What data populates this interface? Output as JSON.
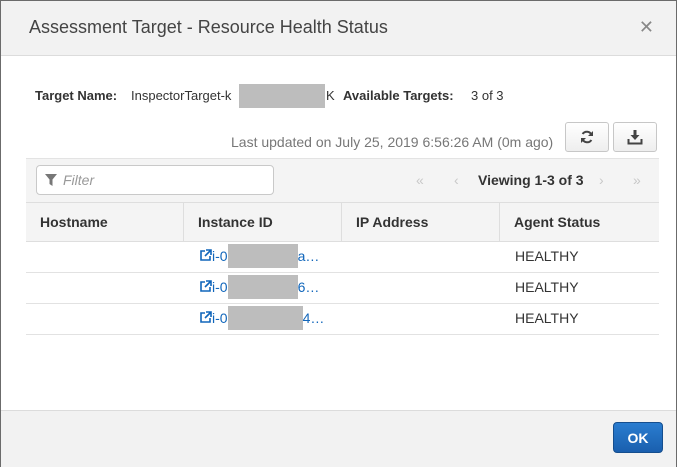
{
  "dialog": {
    "title": "Assessment Target - Resource Health Status",
    "close_glyph": "✕",
    "ok_label": "OK"
  },
  "target": {
    "name_label": "Target Name:",
    "name_prefix": "InspectorTarget-k",
    "name_suffix": "K",
    "available_label": "Available Targets:",
    "available_value": "3 of 3"
  },
  "last_updated": "Last updated on July 25, 2019 6:56:26 AM (0m ago)",
  "toolbar": {
    "filter_placeholder": "Filter",
    "viewing": "Viewing 1-3 of 3"
  },
  "table": {
    "columns": [
      "Hostname",
      "Instance ID",
      "IP Address",
      "Agent Status"
    ],
    "rows": [
      {
        "hostname": "",
        "instance_prefix": "i-0",
        "instance_suffix": "a…",
        "ip": "",
        "status": "HEALTHY"
      },
      {
        "hostname": "",
        "instance_prefix": "i-0",
        "instance_suffix": "6…",
        "ip": "",
        "status": "HEALTHY"
      },
      {
        "hostname": "",
        "instance_prefix": "i-0",
        "instance_suffix": "4…",
        "ip": "",
        "status": "HEALTHY"
      }
    ]
  },
  "icons": {
    "refresh": "refresh-icon",
    "download": "download-icon",
    "filter": "filter-icon",
    "external_link": "external-link-icon"
  },
  "colors": {
    "link": "#1166bb",
    "primary_button": "#1f6cc0"
  }
}
